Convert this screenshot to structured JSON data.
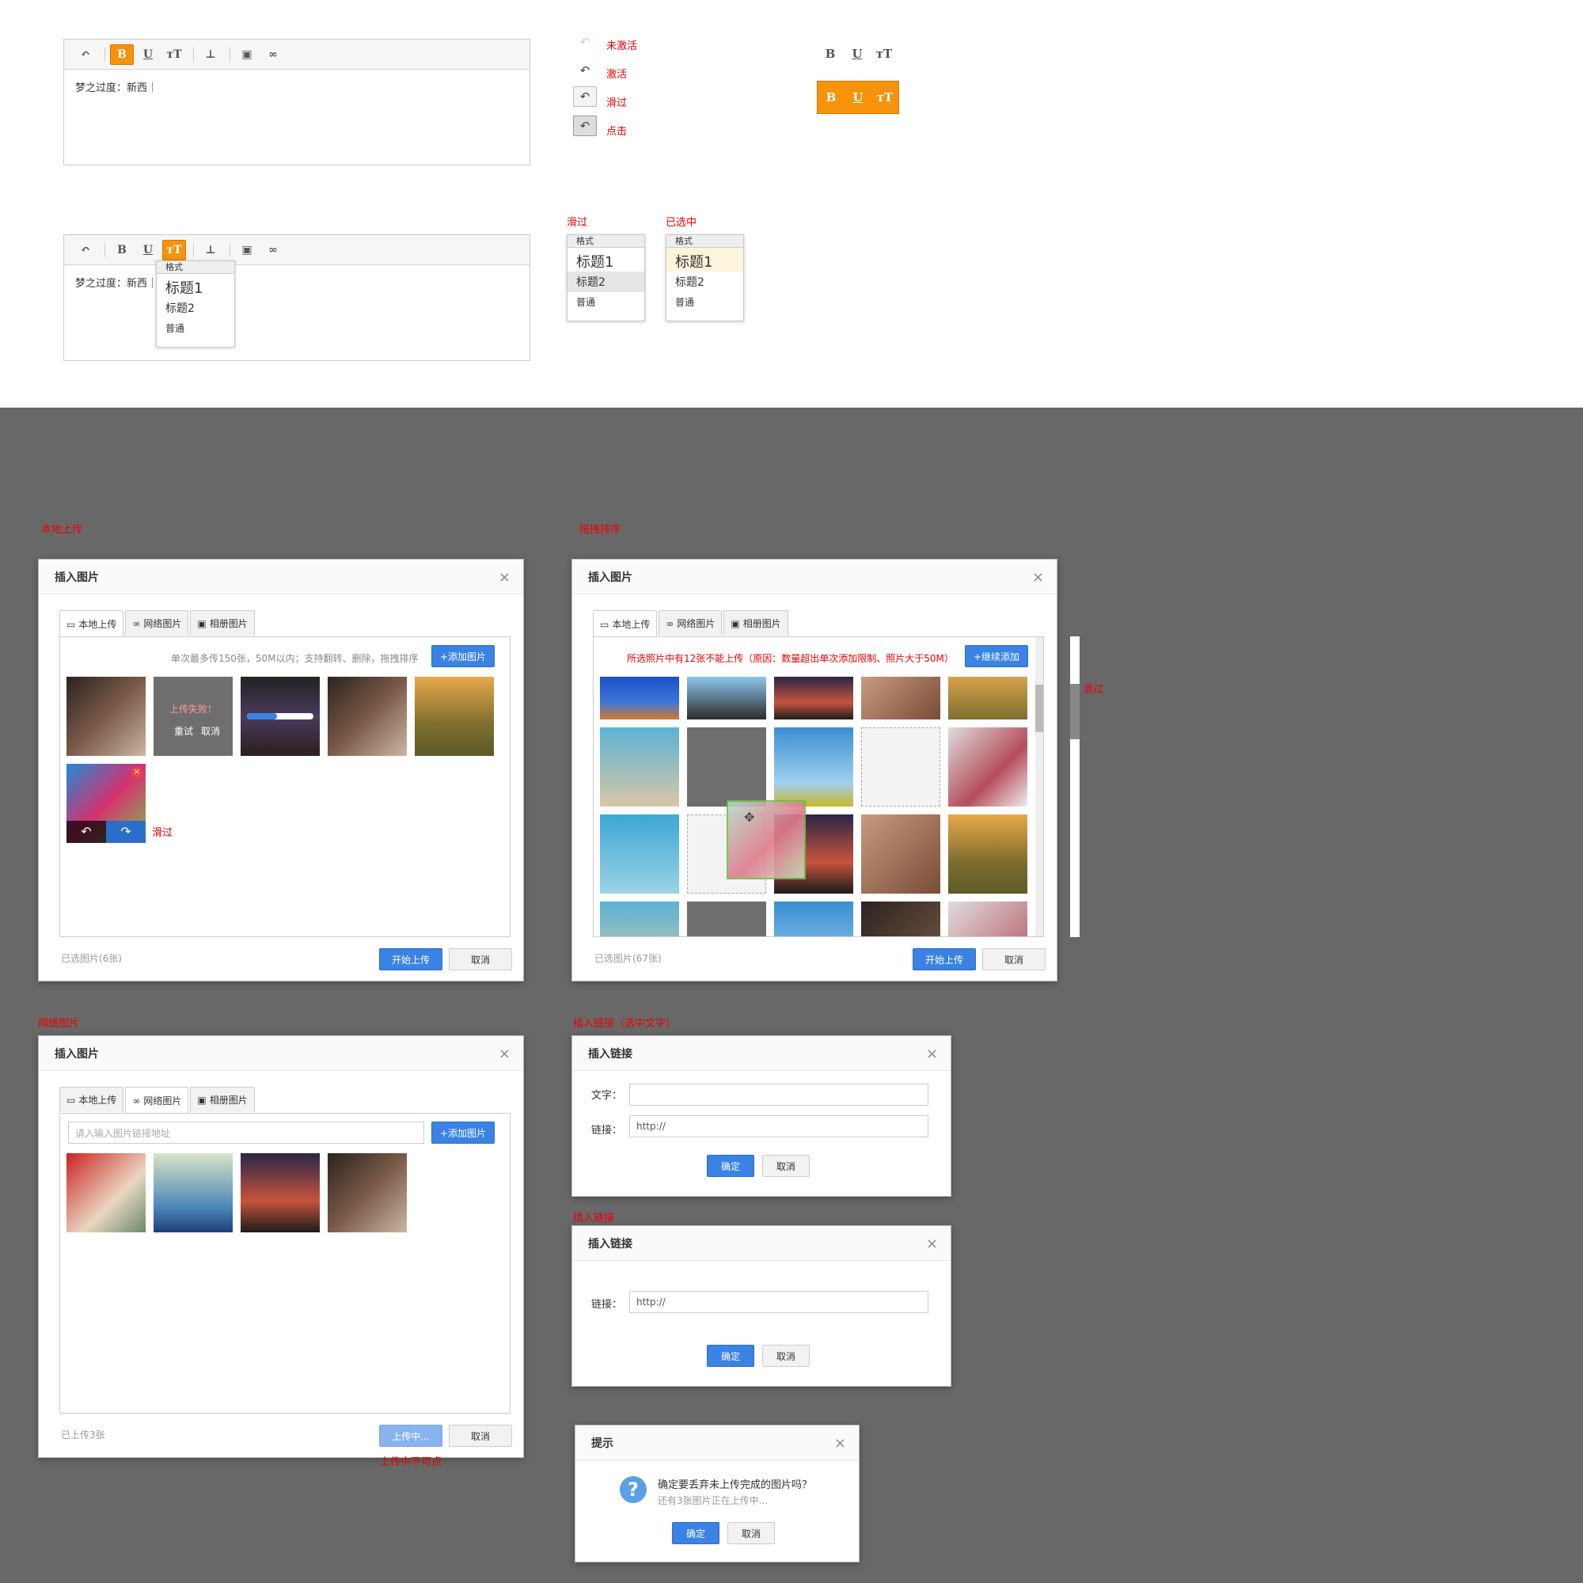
{
  "editor1": {
    "content": "梦之过度：新西｜"
  },
  "editor2": {
    "content": "梦之过度：新西｜"
  },
  "format_menu": {
    "header": "格式",
    "h1": "标题1",
    "h2": "标题2",
    "normal": "普通"
  },
  "states": {
    "inactive": "未激活",
    "active": "激活",
    "hover": "滑过",
    "click": "点击"
  },
  "dd_labels": {
    "hover": "滑过",
    "selected": "已选中"
  },
  "sections": {
    "local": "本地上传",
    "drag": "拖拽排序",
    "net": "网络图片",
    "link_sel": "插入链接（选中文字）",
    "link": "插入链接",
    "hover": "滑过",
    "hover2": "滑过",
    "uploading_disabled": "上传中不可点"
  },
  "dialog": {
    "title": "插入图片",
    "tabs": [
      "本地上传",
      "网络图片",
      "相册图片"
    ],
    "hint": "单次最多传150张，50M以内；支持翻转、删除，拖拽排序",
    "add": "+添加图片",
    "add_more": "+继续添加",
    "error_msg": "所选照片中有12张不能上传（原因：数量超出单次添加限制、照片大于50M）",
    "upload_fail": "上传失败！",
    "retry": "重试",
    "cancel_small": "取消",
    "start": "开始上传",
    "cancel": "取消",
    "selected1": "已选图片(6张)",
    "selected2": "已选图片(67张)",
    "uploaded": "已上传3张",
    "uploading": "上传中...",
    "url_placeholder": "请入输入图片链接地址"
  },
  "link_dialog": {
    "title": "插入链接",
    "text_label": "文字：",
    "link_label": "链接：",
    "link_value": "http://",
    "ok": "确定",
    "cancel": "取消"
  },
  "confirm": {
    "title": "提示",
    "msg": "确定要丢弃未上传完成的图片吗？",
    "sub": "还有3张图片正在上传中...",
    "ok": "确定",
    "cancel": "取消"
  },
  "colors": {
    "accent": "#f7920b",
    "blue": "#3a83e4",
    "red": "#ee0000",
    "bg_gray": "#686868"
  },
  "progress": 0.45
}
